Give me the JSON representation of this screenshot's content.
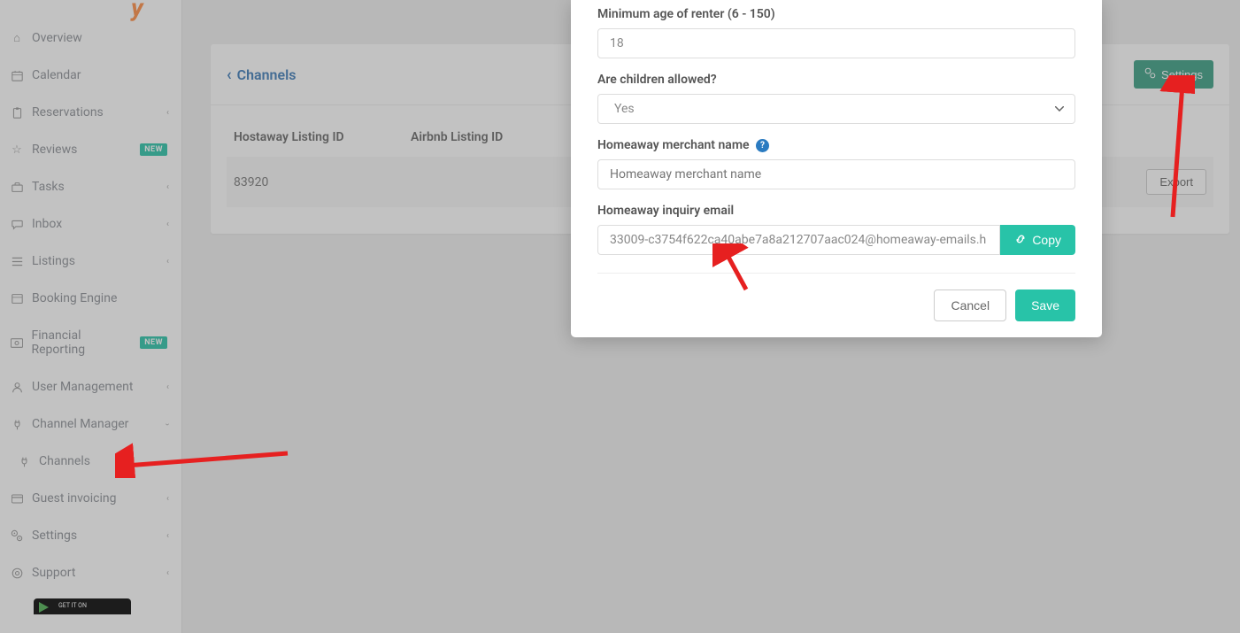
{
  "sidebar": {
    "items": [
      {
        "label": "Overview"
      },
      {
        "label": "Calendar"
      },
      {
        "label": "Reservations"
      },
      {
        "label": "Reviews",
        "badge": "NEW"
      },
      {
        "label": "Tasks"
      },
      {
        "label": "Inbox"
      },
      {
        "label": "Listings"
      },
      {
        "label": "Booking Engine"
      },
      {
        "label": "Financial Reporting",
        "badge": "NEW"
      },
      {
        "label": "User Management"
      },
      {
        "label": "Channel Manager"
      },
      {
        "label": "Channels"
      },
      {
        "label": "Guest invoicing"
      },
      {
        "label": "Settings"
      },
      {
        "label": "Support"
      }
    ],
    "googleplay_pre": "GET IT ON"
  },
  "page": {
    "back_label": "Channels",
    "settings_btn": "Settings",
    "table": {
      "col1": "Hostaway Listing ID",
      "col2": "Airbnb Listing ID",
      "row_id": "83920",
      "export_btn": "Export"
    }
  },
  "modal": {
    "min_age_label": "Minimum age of renter (6 - 150)",
    "min_age_value": "18",
    "children_label": "Are children allowed?",
    "children_value": "Yes",
    "merchant_label": "Homeaway merchant name",
    "merchant_placeholder": "Homeaway merchant name",
    "inquiry_label": "Homeaway inquiry email",
    "inquiry_value": "33009-c3754f622ca40abe7a8a212707aac024@homeaway-emails.h",
    "copy_btn": "Copy",
    "cancel_btn": "Cancel",
    "save_btn": "Save"
  }
}
